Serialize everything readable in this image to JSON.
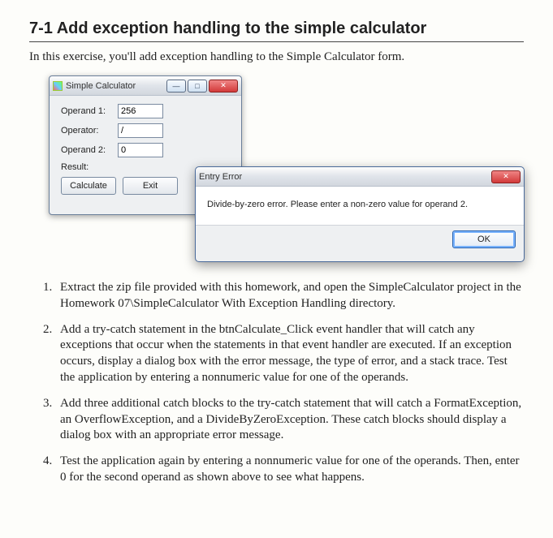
{
  "heading": "7-1  Add exception handling to the simple calculator",
  "intro": "In this exercise, you'll add exception handling to the Simple Calculator form.",
  "calc": {
    "title": "Simple Calculator",
    "labels": {
      "op1": "Operand 1:",
      "op": "Operator:",
      "op2": "Operand 2:",
      "res": "Result:"
    },
    "values": {
      "op1": "256",
      "op": "/",
      "op2": "0",
      "res": ""
    },
    "buttons": {
      "calc": "Calculate",
      "exit": "Exit"
    },
    "winbtn": {
      "min": "—",
      "max": "□",
      "close": "✕"
    }
  },
  "error": {
    "title": "Entry Error",
    "message": "Divide-by-zero error. Please enter a non-zero value for operand 2.",
    "ok": "OK",
    "close": "✕"
  },
  "steps": [
    "Extract the zip file provided with this homework, and open the SimpleCalculator project in the Homework 07\\SimpleCalculator With Exception Handling directory.",
    "Add a try-catch statement in the btnCalculate_Click event handler that will catch any exceptions that occur when the statements in that event handler are executed. If an exception occurs, display a dialog box with the error message, the type of error, and a stack trace. Test the application by entering a nonnumeric value for one of the operands.",
    "Add three additional catch blocks to the try-catch statement that will catch a FormatException, an OverflowException, and a DivideByZeroException. These catch blocks should display a dialog box with an appropriate error message.",
    "Test the application again by entering a nonnumeric value for one of the operands. Then, enter 0 for the second operand as shown above to see what happens."
  ]
}
